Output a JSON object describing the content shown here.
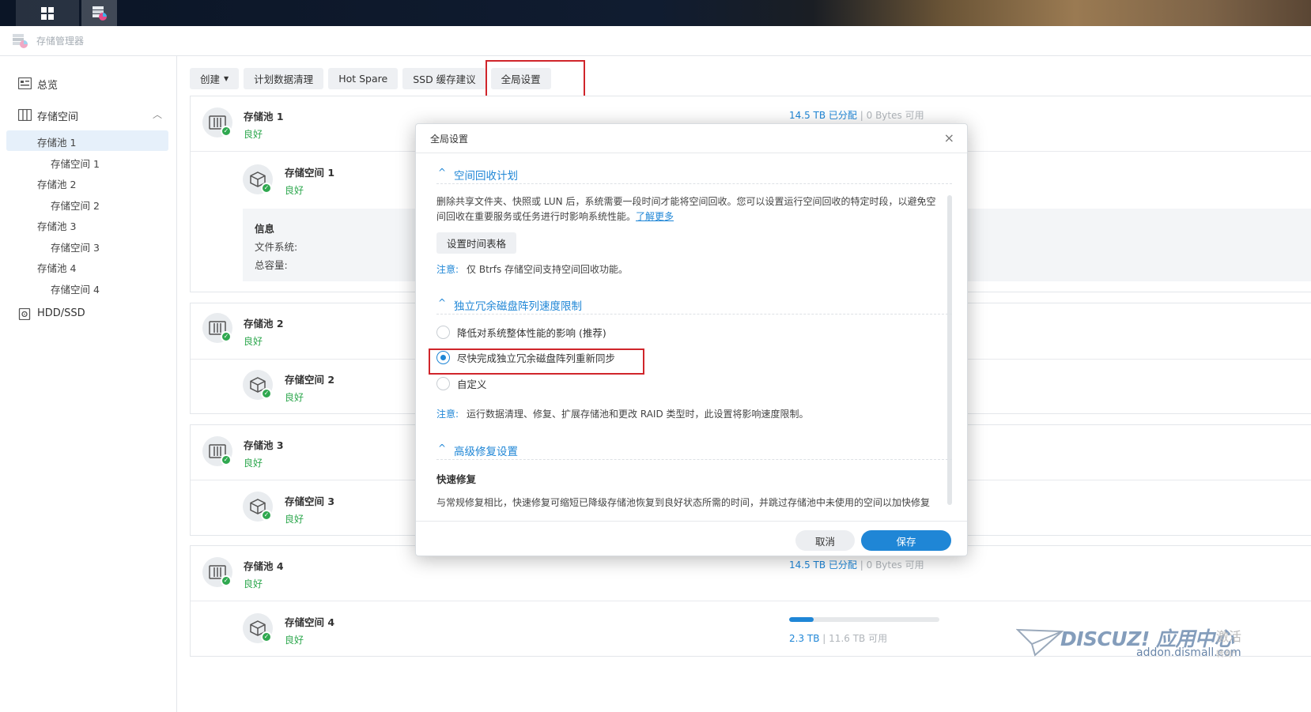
{
  "app": {
    "title": "存储管理器"
  },
  "sidebar": {
    "overview": "总览",
    "storage": "存储空间",
    "items": [
      {
        "label": "存储池 1"
      },
      {
        "label": "存储空间 1"
      },
      {
        "label": "存储池 2"
      },
      {
        "label": "存储空间 2"
      },
      {
        "label": "存储池 3"
      },
      {
        "label": "存储空间 3"
      },
      {
        "label": "存储池 4"
      },
      {
        "label": "存储空间 4"
      }
    ],
    "hdd": "HDD/SSD"
  },
  "toolbar": {
    "create": "创建",
    "scrub": "计划数据清理",
    "hotspare": "Hot Spare",
    "ssd": "SSD 缓存建议",
    "global": "全局设置"
  },
  "pools": [
    {
      "name": "存储池 1",
      "status": "良好",
      "used": "14.5 TB 已分配",
      "sep": "|",
      "free": "0 Bytes 可用",
      "volume": {
        "name": "存储空间 1",
        "status": "良好"
      },
      "info": {
        "title": "信息",
        "fs": "文件系统:",
        "cap": "总容量:"
      }
    },
    {
      "name": "存储池 2",
      "status": "良好",
      "volume": {
        "name": "存储空间 2",
        "status": "良好"
      }
    },
    {
      "name": "存储池 3",
      "status": "良好",
      "volume": {
        "name": "存储空间 3",
        "status": "良好"
      }
    },
    {
      "name": "存储池 4",
      "status": "良好",
      "used": "14.5 TB 已分配",
      "sep": "|",
      "free": "0 Bytes 可用",
      "volume": {
        "name": "存储空间 4",
        "status": "良好",
        "used": "2.3 TB",
        "sep": "|",
        "free": "11.6 TB 可用",
        "progress": 0.165
      }
    }
  ],
  "modal": {
    "title": "全局设置",
    "close": "×",
    "s1": {
      "title": "空间回收计划",
      "desc": "删除共享文件夹、快照或 LUN 后，系统需要一段时间才能将空间回收。您可以设置运行空间回收的特定时段，以避免空间回收在重要服务或任务进行时影响系统性能。",
      "link": "了解更多",
      "btn": "设置时间表格",
      "note_label": "注意:",
      "note": "仅 Btrfs 存储空间支持空间回收功能。"
    },
    "s2": {
      "title": "独立冗余磁盘阵列速度限制",
      "options": [
        {
          "label": "降低对系统整体性能的影响 (推荐)",
          "checked": false
        },
        {
          "label": "尽快完成独立冗余磁盘阵列重新同步",
          "checked": true
        },
        {
          "label": "自定义",
          "checked": false
        }
      ],
      "note_label": "注意:",
      "note": "运行数据清理、修复、扩展存储池和更改 RAID 类型时，此设置将影响速度限制。"
    },
    "s3": {
      "title": "高级修复设置",
      "sub": "快速修复",
      "desc": "与常规修复相比，快速修复可缩短已降级存储池恢复到良好状态所需的时间，并跳过存储池中未使用的空间以加快修复"
    },
    "cancel": "取消",
    "save": "保存"
  },
  "watermark": {
    "brand": "DISCUZ! 应用中心",
    "url": "addon.dismall.com",
    "extra": "激活",
    "extra2": "转到\""
  },
  "colors": {
    "accent": "#1f86d6",
    "ok": "#2fa84f",
    "highlight": "#d0252b"
  }
}
